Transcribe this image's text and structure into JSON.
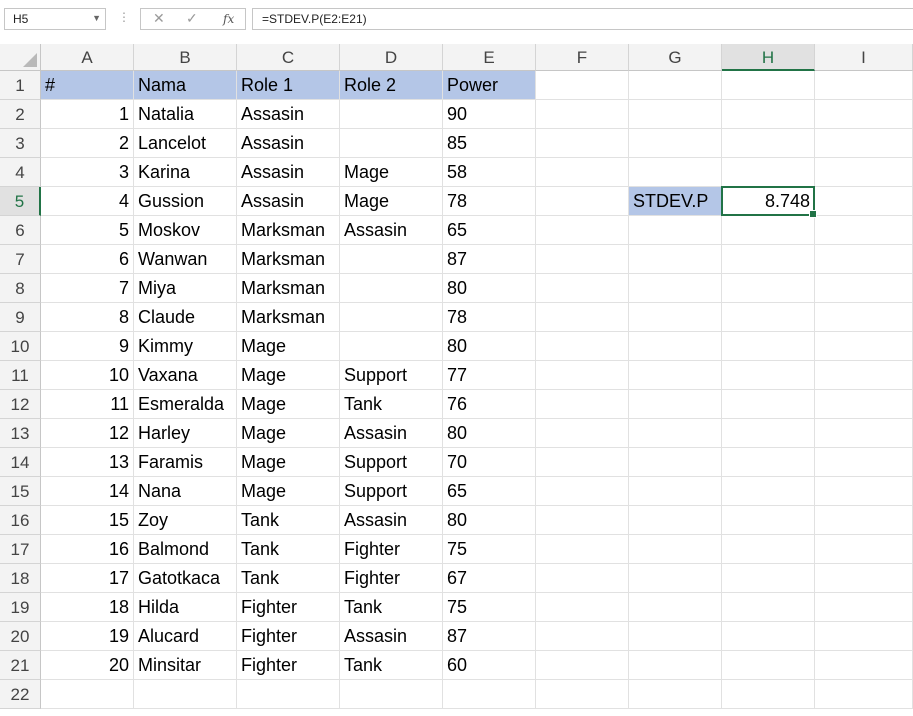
{
  "formula_bar": {
    "name_box": "H5",
    "formula": "=STDEV.P(E2:E21)",
    "cancel_icon": "✕",
    "enter_icon": "✓",
    "fx_label": "fx"
  },
  "columns": [
    "A",
    "B",
    "C",
    "D",
    "E",
    "F",
    "G",
    "H",
    "I"
  ],
  "rows": [
    "1",
    "2",
    "3",
    "4",
    "5",
    "6",
    "7",
    "8",
    "9",
    "10",
    "11",
    "12",
    "13",
    "14",
    "15",
    "16",
    "17",
    "18",
    "19",
    "20",
    "21",
    "22"
  ],
  "table": {
    "headers": [
      "#",
      "Nama",
      "Role 1",
      "Role 2",
      "Power"
    ],
    "records": [
      [
        "1",
        "Natalia",
        "Assasin",
        "",
        "90"
      ],
      [
        "2",
        "Lancelot",
        "Assasin",
        "",
        "85"
      ],
      [
        "3",
        "Karina",
        "Assasin",
        "Mage",
        "58"
      ],
      [
        "4",
        "Gussion",
        "Assasin",
        "Mage",
        "78"
      ],
      [
        "5",
        "Moskov",
        "Marksman",
        "Assasin",
        "65"
      ],
      [
        "6",
        "Wanwan",
        "Marksman",
        "",
        "87"
      ],
      [
        "7",
        "Miya",
        "Marksman",
        "",
        "80"
      ],
      [
        "8",
        "Claude",
        "Marksman",
        "",
        "78"
      ],
      [
        "9",
        "Kimmy",
        "Mage",
        "",
        "80"
      ],
      [
        "10",
        "Vaxana",
        "Mage",
        "Support",
        "77"
      ],
      [
        "11",
        "Esmeralda",
        "Mage",
        "Tank",
        "76"
      ],
      [
        "12",
        "Harley",
        "Mage",
        "Assasin",
        "80"
      ],
      [
        "13",
        "Faramis",
        "Mage",
        "Support",
        "70"
      ],
      [
        "14",
        "Nana",
        "Mage",
        "Support",
        "65"
      ],
      [
        "15",
        "Zoy",
        "Tank",
        "Assasin",
        "80"
      ],
      [
        "16",
        "Balmond",
        "Tank",
        "Fighter",
        "75"
      ],
      [
        "17",
        "Gatotkaca",
        "Tank",
        "Fighter",
        "67"
      ],
      [
        "18",
        "Hilda",
        "Fighter",
        "Tank",
        "75"
      ],
      [
        "19",
        "Alucard",
        "Fighter",
        "Assasin",
        "87"
      ],
      [
        "20",
        "Minsitar",
        "Fighter",
        "Tank",
        "60"
      ]
    ]
  },
  "stat": {
    "label": "STDEV.P",
    "value": "8.748"
  },
  "active_cell": "H5",
  "colors": {
    "header_fill": "#b4c6e7",
    "selection": "#217346"
  }
}
